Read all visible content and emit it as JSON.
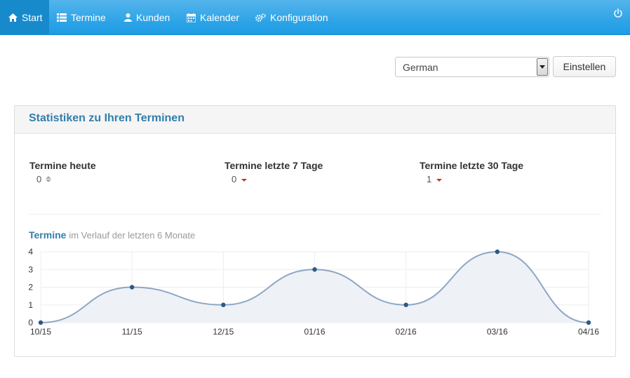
{
  "nav": {
    "items": [
      {
        "label": "Start",
        "icon": "home-icon",
        "active": true
      },
      {
        "label": "Termine",
        "icon": "list-icon",
        "active": false
      },
      {
        "label": "Kunden",
        "icon": "user-icon",
        "active": false
      },
      {
        "label": "Kalender",
        "icon": "calendar-icon",
        "active": false
      },
      {
        "label": "Konfiguration",
        "icon": "cogs-icon",
        "active": false
      }
    ],
    "power_icon": "power-icon"
  },
  "language": {
    "selected": "German",
    "button": "Einstellen"
  },
  "panel": {
    "title": "Statistiken zu Ihren Terminen",
    "stats": [
      {
        "label": "Termine heute",
        "value": "0",
        "trend": "neutral"
      },
      {
        "label": "Termine letzte 7 Tage",
        "value": "0",
        "trend": "down"
      },
      {
        "label": "Termine letzte 30 Tage",
        "value": "1",
        "trend": "down"
      }
    ],
    "chart_heading": {
      "main": "Termine",
      "sub": "im Verlauf der letzten 6 Monate"
    }
  },
  "chart_data": {
    "type": "area",
    "categories": [
      "10/15",
      "11/15",
      "12/15",
      "01/16",
      "02/16",
      "03/16",
      "04/16"
    ],
    "series": [
      {
        "values": [
          0,
          2,
          1,
          3,
          1,
          4,
          0
        ]
      }
    ],
    "ylim": [
      0,
      4
    ],
    "yticks": [
      0,
      1,
      2,
      3,
      4
    ],
    "grid": true,
    "colors": {
      "line": "#8ea6c3",
      "fill": "#eef1f6",
      "point": "#2a5a88"
    }
  },
  "colors": {
    "navbar": "#2fa4e7",
    "nav_active": "#178acc",
    "heading": "#317eac"
  }
}
